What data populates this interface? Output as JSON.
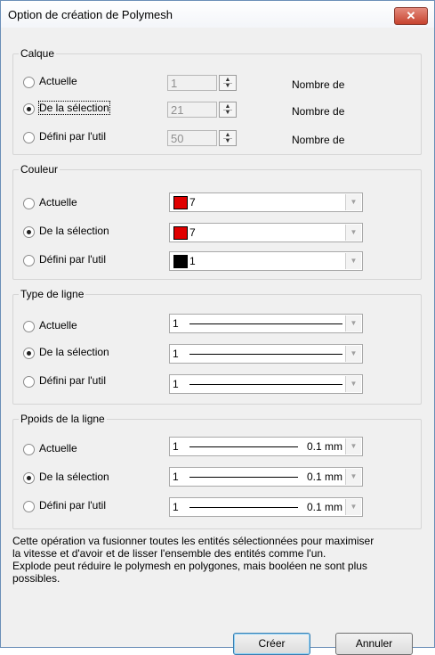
{
  "window": {
    "title": "Option de création de Polymesh",
    "close_label": "✕"
  },
  "calque": {
    "legend": "Calque",
    "rows": [
      {
        "label": "Actuelle",
        "value": "1",
        "right_label": "Nombre de",
        "checked": false
      },
      {
        "label": "De la sélection",
        "value": "21",
        "right_label": "Nombre de",
        "checked": true
      },
      {
        "label": "Défini par l'util",
        "value": "50",
        "right_label": "Nombre de",
        "checked": false
      }
    ]
  },
  "couleur": {
    "legend": "Couleur",
    "rows": [
      {
        "label": "Actuelle",
        "value": "7",
        "swatch": "#e00000",
        "checked": false
      },
      {
        "label": "De la sélection",
        "value": "7",
        "swatch": "#e00000",
        "checked": true
      },
      {
        "label": "Défini par l'util",
        "value": "1",
        "swatch": "#000000",
        "checked": false
      }
    ]
  },
  "type_ligne": {
    "legend": "Type de ligne",
    "rows": [
      {
        "label": "Actuelle",
        "value": "1",
        "checked": false
      },
      {
        "label": "De la sélection",
        "value": "1",
        "checked": true
      },
      {
        "label": "Défini par l'util",
        "value": "1",
        "checked": false
      }
    ]
  },
  "poids_ligne": {
    "legend": "Ppoids de la ligne",
    "rows": [
      {
        "label": "Actuelle",
        "value": "1",
        "weight": "0.1 mm",
        "checked": false
      },
      {
        "label": "De la sélection",
        "value": "1",
        "weight": "0.1 mm",
        "checked": true
      },
      {
        "label": "Défini par l'util",
        "value": "1",
        "weight": "0.1 mm",
        "checked": false
      }
    ]
  },
  "description": {
    "line1": "Cette opération va fusionner toutes les entités sélectionnées pour maximiser",
    "line2": "la vitesse et d'avoir et de lisser l'ensemble des entités comme l'un.",
    "line3": " Explode peut réduire le polymesh en polygones, mais booléen ne sont plus",
    "line4": "possibles."
  },
  "buttons": {
    "create": "Créer",
    "cancel": "Annuler"
  }
}
